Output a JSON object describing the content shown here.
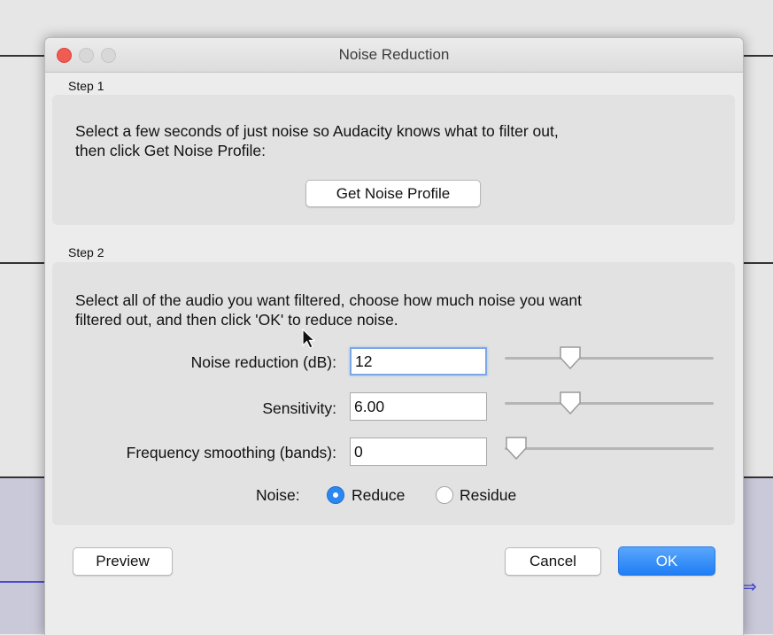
{
  "window": {
    "title": "Noise Reduction"
  },
  "step1": {
    "label": "Step 1",
    "description_line1": "Select a few seconds of just noise so Audacity knows what to filter out,",
    "description_line2": "then click Get Noise Profile:",
    "get_profile_button": "Get Noise Profile"
  },
  "step2": {
    "label": "Step 2",
    "description_line1": "Select all of the audio you want filtered, choose how much noise you want",
    "description_line2": "filtered out, and then click 'OK' to reduce noise.",
    "noise_reduction": {
      "label": "Noise reduction (dB):",
      "value": "12",
      "slider_fraction": 0.29
    },
    "sensitivity": {
      "label": "Sensitivity:",
      "value": "6.00",
      "slider_fraction": 0.29
    },
    "frequency_smoothing": {
      "label": "Frequency smoothing (bands):",
      "value": "0",
      "slider_fraction": 0.0
    },
    "noise": {
      "label": "Noise:",
      "options": [
        "Reduce",
        "Residue"
      ],
      "selected": "Reduce"
    }
  },
  "buttons": {
    "preview": "Preview",
    "cancel": "Cancel",
    "ok": "OK"
  },
  "colors": {
    "accent": "#2b88f1",
    "close": "#f05b52"
  },
  "icons": {
    "cursor": "arrow-pointer-icon"
  }
}
